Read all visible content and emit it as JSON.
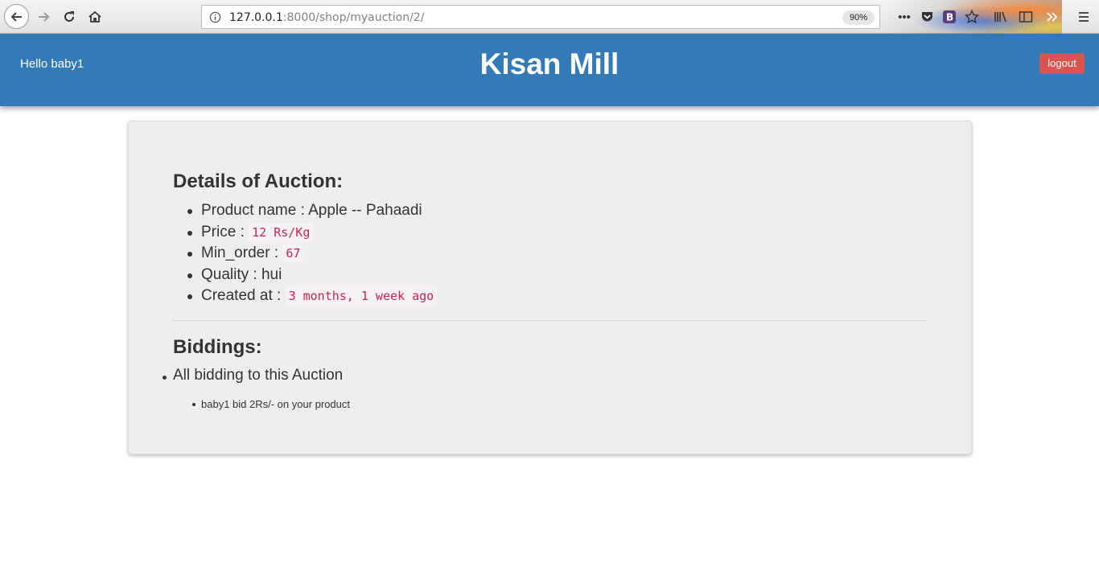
{
  "browser": {
    "url_host": "127.0.0.1",
    "url_rest": ":8000/shop/myauction/2/",
    "zoom": "90%",
    "icons": [
      "back-icon",
      "forward-icon",
      "reload-icon",
      "home-icon",
      "info-icon",
      "more-icon",
      "pocket-icon",
      "bootstrap-extension-icon",
      "bookmark-star-icon",
      "library-icon",
      "sidebar-icon",
      "overflow-icon",
      "menu-icon"
    ]
  },
  "header": {
    "greeting": "Hello baby1",
    "title": "Kisan Mill",
    "logout_label": "logout",
    "brand_color": "#337ab7",
    "logout_color": "#d9534f"
  },
  "auction": {
    "heading": "Details of Auction:",
    "details": [
      {
        "label": "Product name : ",
        "text": "Apple -- Pahaadi"
      },
      {
        "label": "Price : ",
        "code": "12 Rs/Kg"
      },
      {
        "label": "Min_order : ",
        "code": "67"
      },
      {
        "label": "Quality : ",
        "text": "hui"
      },
      {
        "label": "Created at : ",
        "code": "3 months, 1 week ago"
      }
    ]
  },
  "biddings": {
    "heading": "Biddings:",
    "summary": "All bidding to this Auction",
    "items": [
      "baby1 bid 2Rs/- on your product"
    ]
  }
}
